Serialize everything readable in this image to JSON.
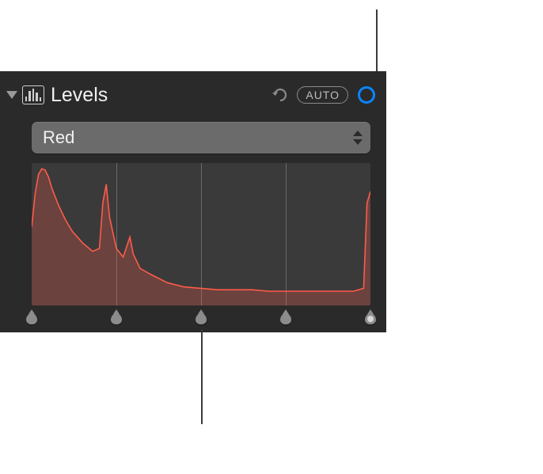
{
  "panel": {
    "title": "Levels",
    "auto_label": "AUTO"
  },
  "channel": {
    "selected": "Red"
  },
  "chart_data": {
    "type": "area",
    "title": "",
    "xlabel": "",
    "ylabel": "",
    "xlim": [
      0,
      255
    ],
    "ylim": [
      0,
      100
    ],
    "grid_positions_pct": [
      25,
      50,
      75
    ],
    "handles_pct": [
      0,
      25,
      50,
      75,
      100
    ],
    "series": [
      {
        "name": "Red channel histogram",
        "color": "#ff5b4a",
        "x_pct": [
          0,
          1,
          2,
          3,
          4,
          5,
          6,
          8,
          10,
          12,
          15,
          18,
          20,
          21,
          22,
          23,
          25,
          27,
          29,
          30,
          32,
          35,
          40,
          45,
          50,
          55,
          60,
          65,
          70,
          75,
          80,
          85,
          90,
          95,
          98,
          99,
          100
        ],
        "y_pct": [
          55,
          78,
          92,
          96,
          95,
          90,
          82,
          70,
          60,
          52,
          44,
          38,
          40,
          72,
          85,
          62,
          40,
          34,
          48,
          36,
          26,
          22,
          16,
          13,
          12,
          11,
          11,
          11,
          10,
          10,
          10,
          10,
          10,
          10,
          12,
          72,
          80
        ]
      }
    ]
  },
  "colors": {
    "accent": "#0a84ff",
    "panel_bg": "#2a2a2a",
    "histogram_bg": "#3a3a3a",
    "histogram_stroke": "#ff5b4a",
    "histogram_fill": "rgba(255,91,74,0.25)"
  }
}
